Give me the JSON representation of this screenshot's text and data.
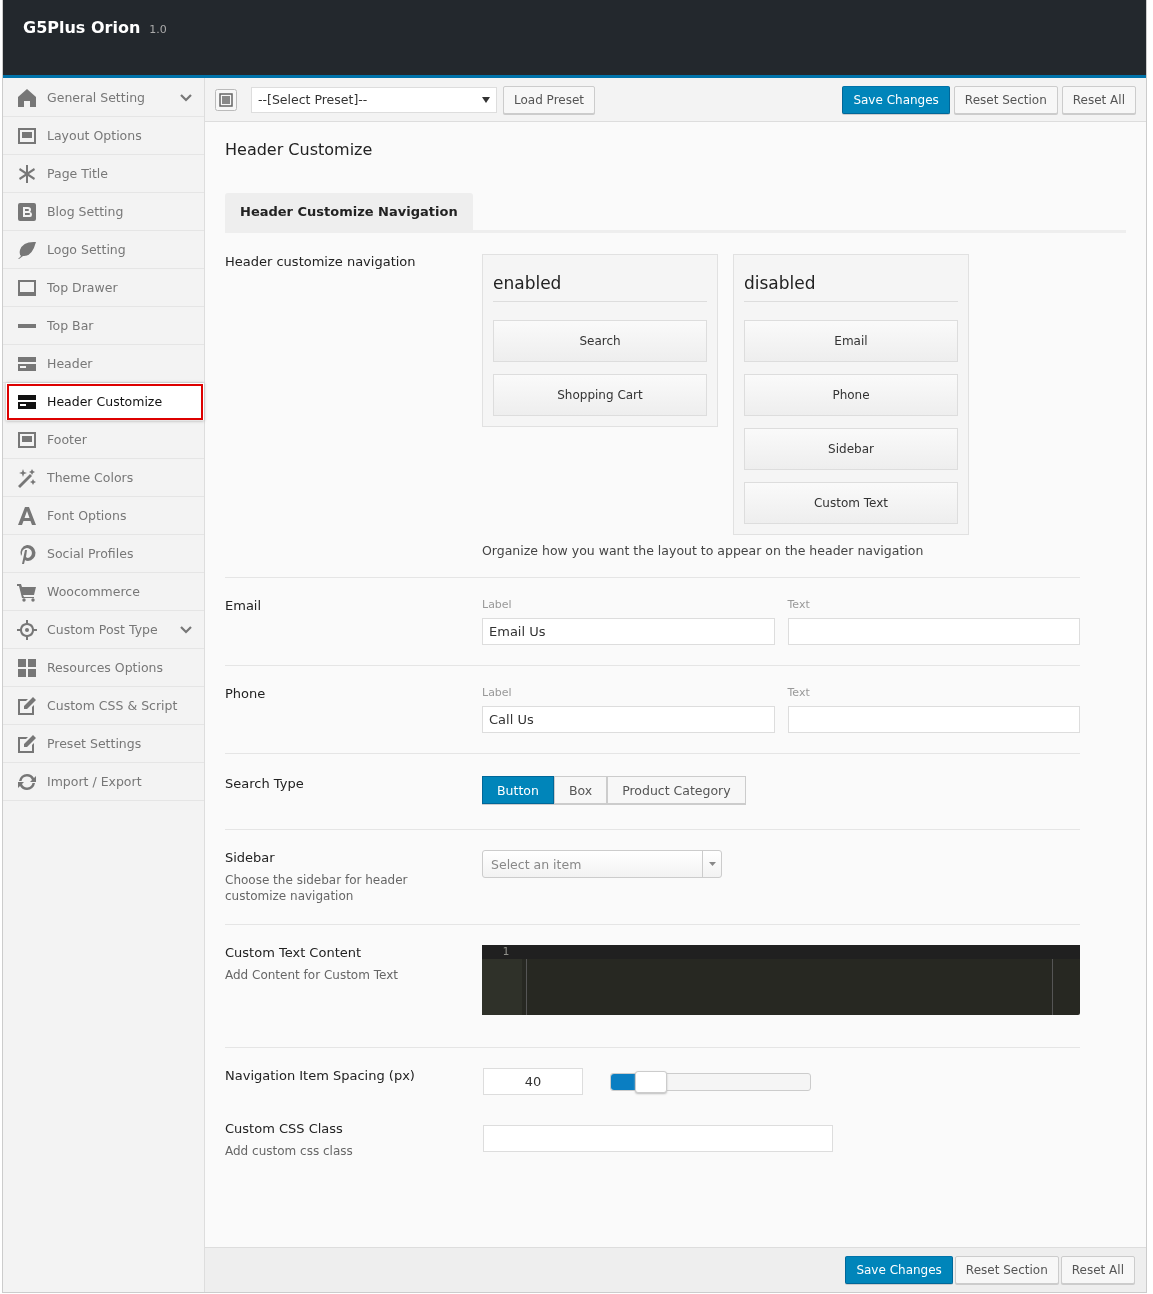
{
  "app": {
    "title": "G5Plus Orion",
    "version": "1.0"
  },
  "sidebar": {
    "items": [
      {
        "label": "General Setting",
        "selected": false,
        "has_submenu": true
      },
      {
        "label": "Layout Options",
        "selected": false,
        "has_submenu": false
      },
      {
        "label": "Page Title",
        "selected": false,
        "has_submenu": false
      },
      {
        "label": "Blog Setting",
        "selected": false,
        "has_submenu": false
      },
      {
        "label": "Logo Setting",
        "selected": false,
        "has_submenu": false
      },
      {
        "label": "Top Drawer",
        "selected": false,
        "has_submenu": false
      },
      {
        "label": "Top Bar",
        "selected": false,
        "has_submenu": false
      },
      {
        "label": "Header",
        "selected": false,
        "has_submenu": false
      },
      {
        "label": "Header Customize",
        "selected": true,
        "has_submenu": false
      },
      {
        "label": "Footer",
        "selected": false,
        "has_submenu": false
      },
      {
        "label": "Theme Colors",
        "selected": false,
        "has_submenu": false
      },
      {
        "label": "Font Options",
        "selected": false,
        "has_submenu": false
      },
      {
        "label": "Social Profiles",
        "selected": false,
        "has_submenu": false
      },
      {
        "label": "Woocommerce",
        "selected": false,
        "has_submenu": false
      },
      {
        "label": "Custom Post Type",
        "selected": false,
        "has_submenu": true
      },
      {
        "label": "Resources Options",
        "selected": false,
        "has_submenu": false
      },
      {
        "label": "Custom CSS & Script",
        "selected": false,
        "has_submenu": false
      },
      {
        "label": "Preset Settings",
        "selected": false,
        "has_submenu": false
      },
      {
        "label": "Import / Export",
        "selected": false,
        "has_submenu": false
      }
    ]
  },
  "toolbar": {
    "preset_select": "--[Select Preset]--",
    "buttons": [
      {
        "label": "Load Preset",
        "primary": false
      }
    ],
    "actions": [
      {
        "label": "Save Changes",
        "primary": true
      },
      {
        "label": "Reset Section",
        "primary": false
      },
      {
        "label": "Reset All",
        "primary": false
      }
    ]
  },
  "section": {
    "title": "Header Customize",
    "tabs": [
      {
        "label": "Header Customize Navigation",
        "selected": true
      }
    ]
  },
  "fields": [
    {
      "kind": "sorter",
      "label": "Header customize navigation",
      "columns": [
        {
          "title": "enabled",
          "items": [
            "Search",
            "Shopping Cart"
          ]
        },
        {
          "title": "disabled",
          "items": [
            "Email",
            "Phone",
            "Sidebar",
            "Custom Text"
          ]
        }
      ],
      "help": "Organize how you want the layout to appear on the header navigation"
    },
    {
      "kind": "pair",
      "label": "Email",
      "inputs": [
        {
          "label": "Label",
          "value": "Email Us"
        },
        {
          "label": "Text"
        }
      ]
    },
    {
      "kind": "pair",
      "label": "Phone",
      "inputs": [
        {
          "label": "Label",
          "value": "Call Us"
        },
        {
          "label": "Text"
        }
      ]
    },
    {
      "kind": "buttonset",
      "label": "Search Type",
      "options": [
        {
          "label": "Button",
          "selected": true
        },
        {
          "label": "Box",
          "selected": false
        },
        {
          "label": "Product Category",
          "selected": false
        }
      ]
    },
    {
      "kind": "select",
      "label": "Sidebar",
      "description": "Choose the sidebar for header customize navigation",
      "placeholder": "Select an item"
    },
    {
      "kind": "code",
      "label": "Custom Text Content",
      "description": "Add Content for Custom Text",
      "line_numbers": [
        "1"
      ]
    },
    {
      "kind": "slider",
      "label": "Navigation Item Spacing (px)",
      "value": "40",
      "level": 0.2
    },
    {
      "kind": "text",
      "label": "Custom CSS Class",
      "description": "Add custom css class"
    }
  ],
  "footer": {
    "actions": [
      {
        "label": "Save Changes",
        "primary": true
      },
      {
        "label": "Reset Section",
        "primary": false
      },
      {
        "label": "Reset All",
        "primary": false
      }
    ]
  }
}
